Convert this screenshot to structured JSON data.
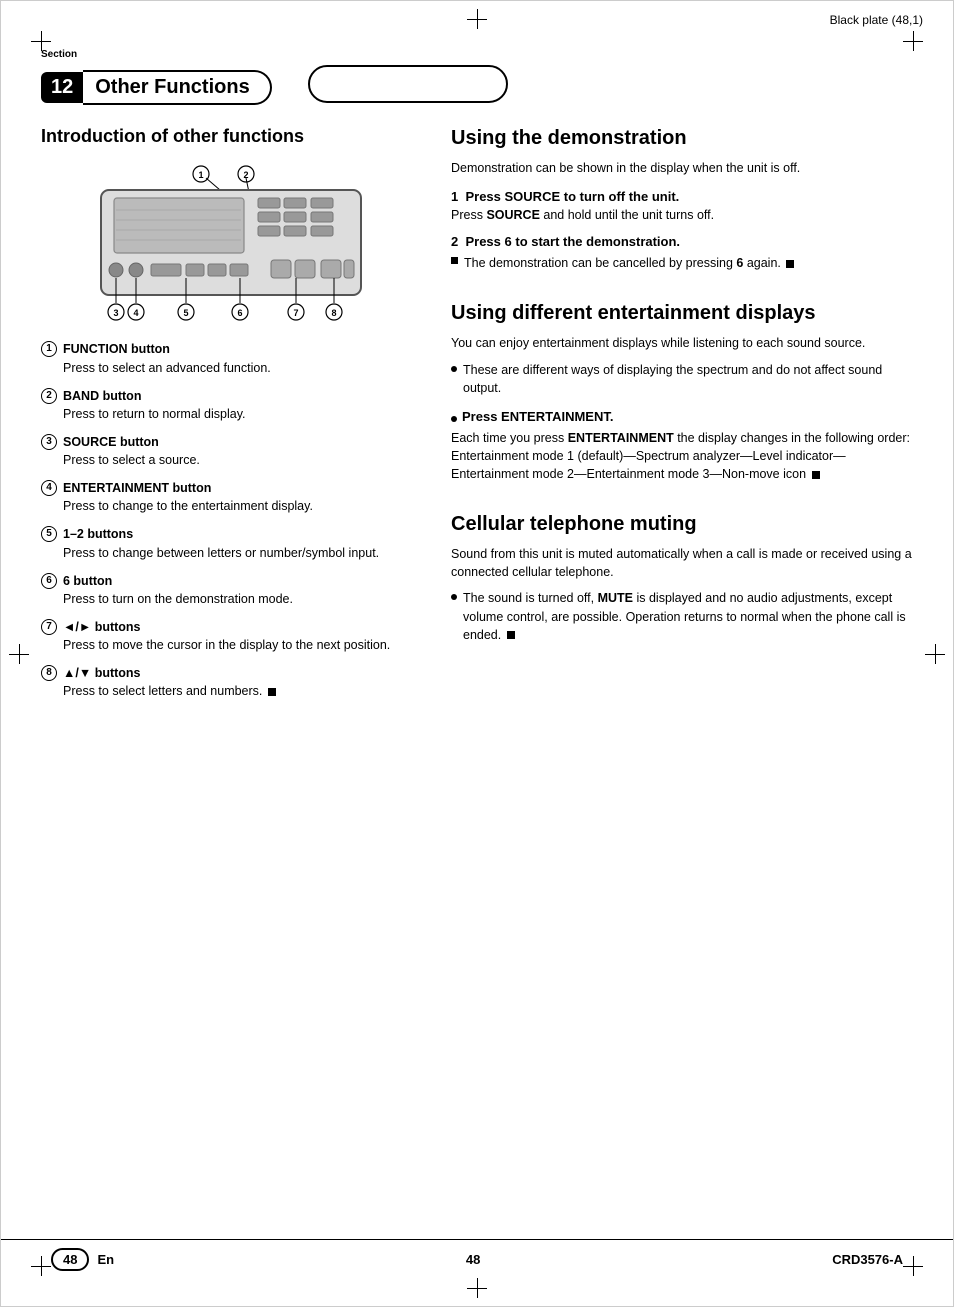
{
  "page": {
    "top_label": "Black plate (48,1)",
    "section_label": "Section",
    "section_number": "12",
    "section_title": "Other Functions",
    "page_number": "48",
    "page_en": "En",
    "footer_center": "48",
    "footer_model": "CRD3576-A"
  },
  "left": {
    "heading": "Introduction of other functions",
    "diagram_labels": [
      "①",
      "②",
      "③",
      "④",
      "⑤",
      "⑥",
      "⑦",
      "⑧"
    ],
    "features": [
      {
        "num": "①",
        "title": "FUNCTION button",
        "desc": "Press to select an advanced function."
      },
      {
        "num": "②",
        "title": "BAND button",
        "desc": "Press to return to normal display."
      },
      {
        "num": "③",
        "title": "SOURCE button",
        "desc": "Press to select a source."
      },
      {
        "num": "④",
        "title": "ENTERTAINMENT button",
        "desc": "Press to change to the entertainment display."
      },
      {
        "num": "⑤",
        "title": "1–2 buttons",
        "desc": "Press to change between letters or number/symbol input."
      },
      {
        "num": "⑥",
        "title": "6 button",
        "desc": "Press to turn on the demonstration mode."
      },
      {
        "num": "⑦",
        "title": "◄/► buttons",
        "desc": "Press to move the cursor in the display to the next position."
      },
      {
        "num": "⑧",
        "title": "▲/▼ buttons",
        "desc": "Press to select letters and numbers."
      }
    ]
  },
  "right": {
    "demo_heading": "Using the demonstration",
    "demo_intro": "Demonstration can be shown in the display when the unit is off.",
    "demo_steps": [
      {
        "num": "1",
        "title": "Press SOURCE to turn off the unit.",
        "body": "Press SOURCE and hold until the unit turns off."
      },
      {
        "num": "2",
        "title": "Press 6 to start the demonstration.",
        "bullets": [
          "The demonstration can be cancelled by pressing 6 again."
        ]
      }
    ],
    "entertainment_heading": "Using different entertainment displays",
    "entertainment_intro": "You can enjoy entertainment displays while listening to each sound source.",
    "entertainment_bullets": [
      "These are different ways of displaying the spectrum and do not affect sound output."
    ],
    "entertainment_step_title": "Press ENTERTAINMENT.",
    "entertainment_step_body": "Each time you press ENTERTAINMENT the display changes in the following order: Entertainment mode 1 (default)—Spectrum analyzer—Level indicator—Entertainment mode 2—Entertainment mode 3—Non-move icon",
    "cellular_heading": "Cellular telephone muting",
    "cellular_intro": "Sound from this unit is muted automatically when a call is made or received using a connected cellular telephone.",
    "cellular_bullets": [
      "The sound is turned off, MUTE is displayed and no audio adjustments, except volume control, are possible. Operation returns to normal when the phone call is ended."
    ]
  }
}
